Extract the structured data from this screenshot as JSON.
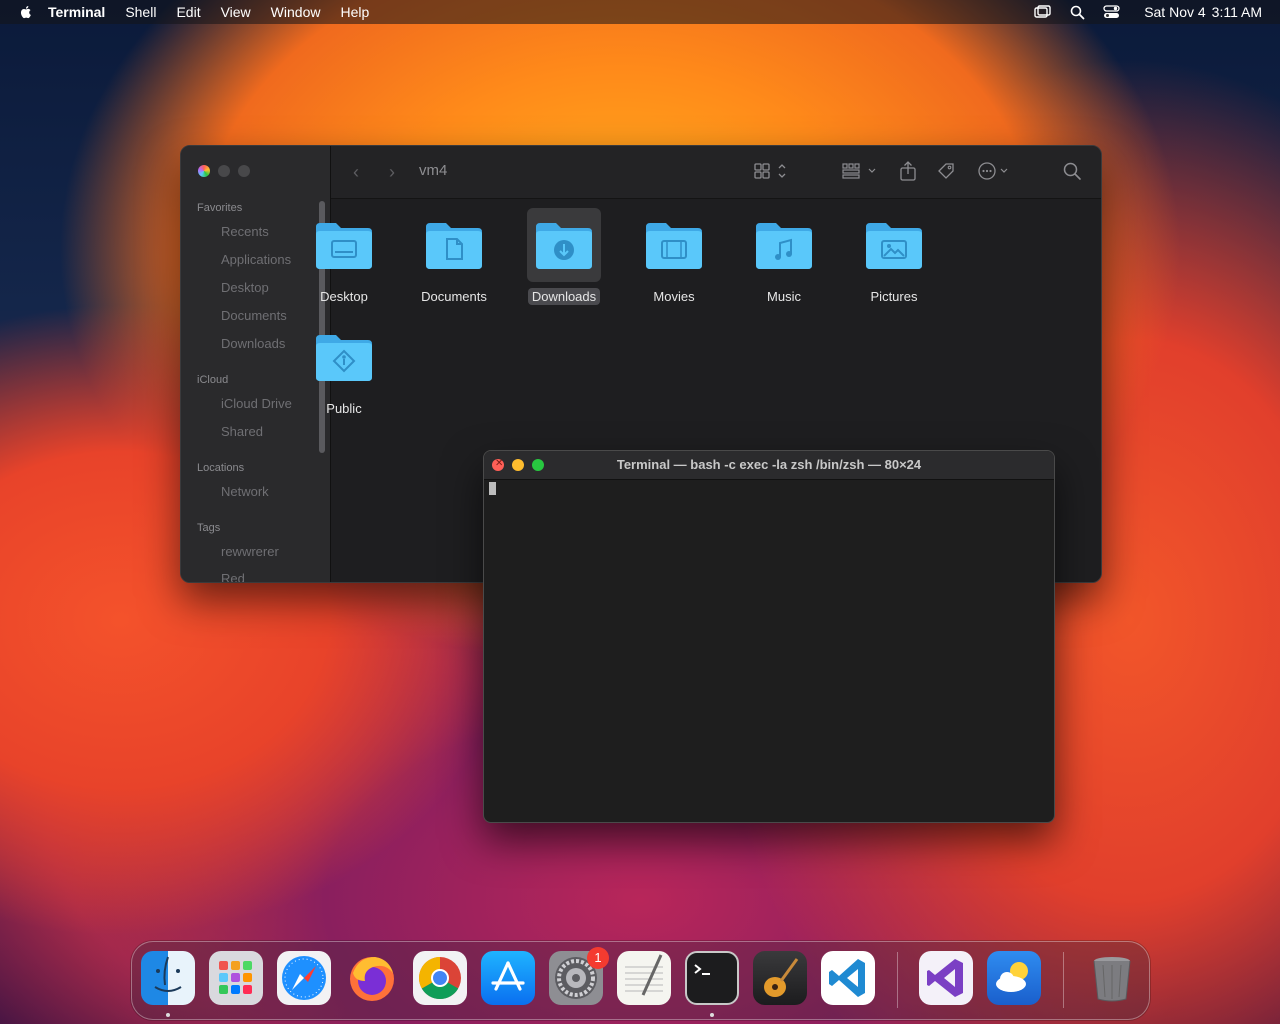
{
  "menubar": {
    "app": "Terminal",
    "items": [
      "Shell",
      "Edit",
      "View",
      "Window",
      "Help"
    ],
    "date": "Sat Nov 4",
    "time": "3:11 AM"
  },
  "finder": {
    "title": "vm4",
    "sidebar": {
      "favorites_label": "Favorites",
      "favorites": [
        "Recents",
        "Applications",
        "Desktop",
        "Documents",
        "Downloads"
      ],
      "icloud_label": "iCloud",
      "icloud": [
        "iCloud Drive",
        "Shared"
      ],
      "locations_label": "Locations",
      "locations": [
        "Network"
      ],
      "tags_label": "Tags",
      "tags": [
        "rewwrerer",
        "Red"
      ]
    },
    "folders": [
      "Desktop",
      "Documents",
      "Downloads",
      "Movies",
      "Music",
      "Pictures",
      "Public"
    ],
    "selected_folder": "Downloads"
  },
  "terminal": {
    "title": "Terminal — bash -c exec -la zsh /bin/zsh — 80×24"
  },
  "dock": {
    "apps": [
      "Finder",
      "Launchpad",
      "Safari",
      "Firefox",
      "Chrome",
      "App Store",
      "System Settings",
      "TextEdit",
      "Terminal",
      "GarageBand",
      "Visual Studio Code",
      "Visual Studio",
      "Weather",
      "Trash"
    ],
    "settings_badge": "1"
  },
  "colors": {
    "folder_blue": "#5ac8fa",
    "close_red": "#ff5f57",
    "minimize_yellow": "#febc2e",
    "zoom_green": "#28c840"
  }
}
